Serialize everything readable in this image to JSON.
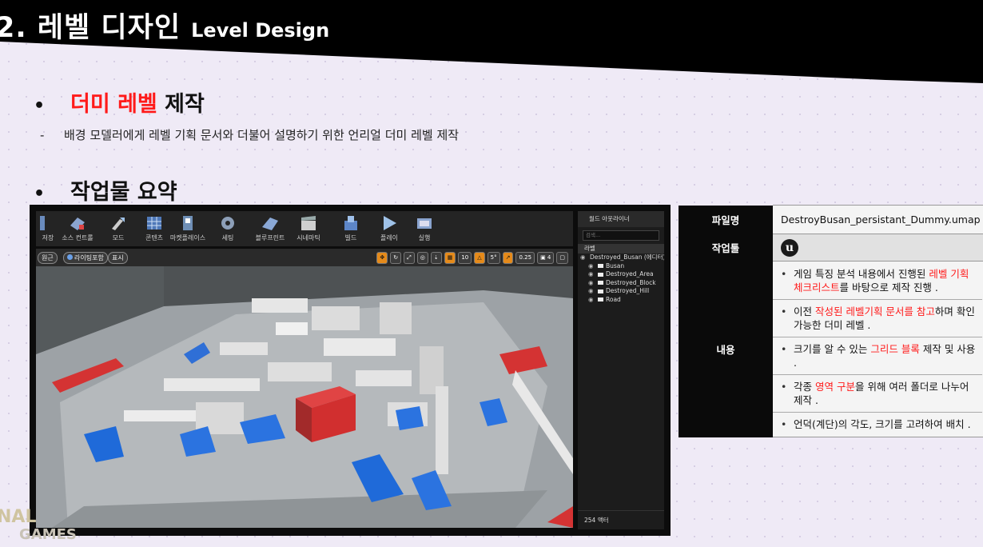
{
  "header": {
    "title_kr": "2. 레벨 디자인",
    "title_en": "Level Design"
  },
  "section1": {
    "highlight": "더미 레벨",
    "rest": " 제작",
    "sub": "배경 모델러에게 레벨 기획 문서와 더불어 설명하기 위한 언리얼 더미 레벨 제작"
  },
  "section2": {
    "title": "작업물 요약"
  },
  "editor": {
    "toolbar": [
      "저장",
      "소스 컨트롤",
      "모드",
      "콘텐츠",
      "마켓플레이스",
      "세팅",
      "블루프린트",
      "시네마틱",
      "빌드",
      "플레이",
      "실행"
    ],
    "viewport_buttons": [
      "원근",
      "라이팅포함",
      "표시"
    ],
    "viewport_values": {
      "grid": "10",
      "rotation": "5°",
      "scale": "0.25",
      "camera": "4"
    },
    "outliner": {
      "title": "월드 아웃라이너",
      "search": "검색...",
      "column": "라벨",
      "items": [
        "Destroyed_Busan (에디터)",
        "Busan",
        "Destroyed_Area",
        "Destroyed_Block",
        "Destroyed_Hill",
        "Road"
      ],
      "footer": "254 액터"
    }
  },
  "info": {
    "file_label": "파일명",
    "file_value": "DestroyBusan_persistant_Dummy.umap",
    "tool_label": "작업툴",
    "tool_logo": "u",
    "content_label": "내용",
    "items": [
      {
        "pre": "게임 특징 분석 내용에서 진행된 ",
        "hl": "레벨 기획 체크리스트",
        "post": "를 바탕으로 제작 진행 ."
      },
      {
        "pre": "이전 ",
        "hl": "작성된 레벨기획 문서를 참고",
        "post": "하며 확인 가능한 더미 레벨 ."
      },
      {
        "pre": "크기를 알 수 있는 ",
        "hl": "그리드 블록",
        "post": " 제작 및 사용 ."
      },
      {
        "pre": "각종 ",
        "hl": "영역 구분",
        "post": "을 위해 여러 폴더로 나누어 제작 ."
      },
      {
        "pre": "언덕(계단)의 각도, 크기를 고려하여 배치 .",
        "hl": "",
        "post": ""
      }
    ]
  },
  "logo": {
    "line1": "NAL",
    "line2": "GAMES"
  },
  "colors": {
    "accent": "#ff1a1a",
    "header": "#000000",
    "background": "#efeaf6"
  }
}
